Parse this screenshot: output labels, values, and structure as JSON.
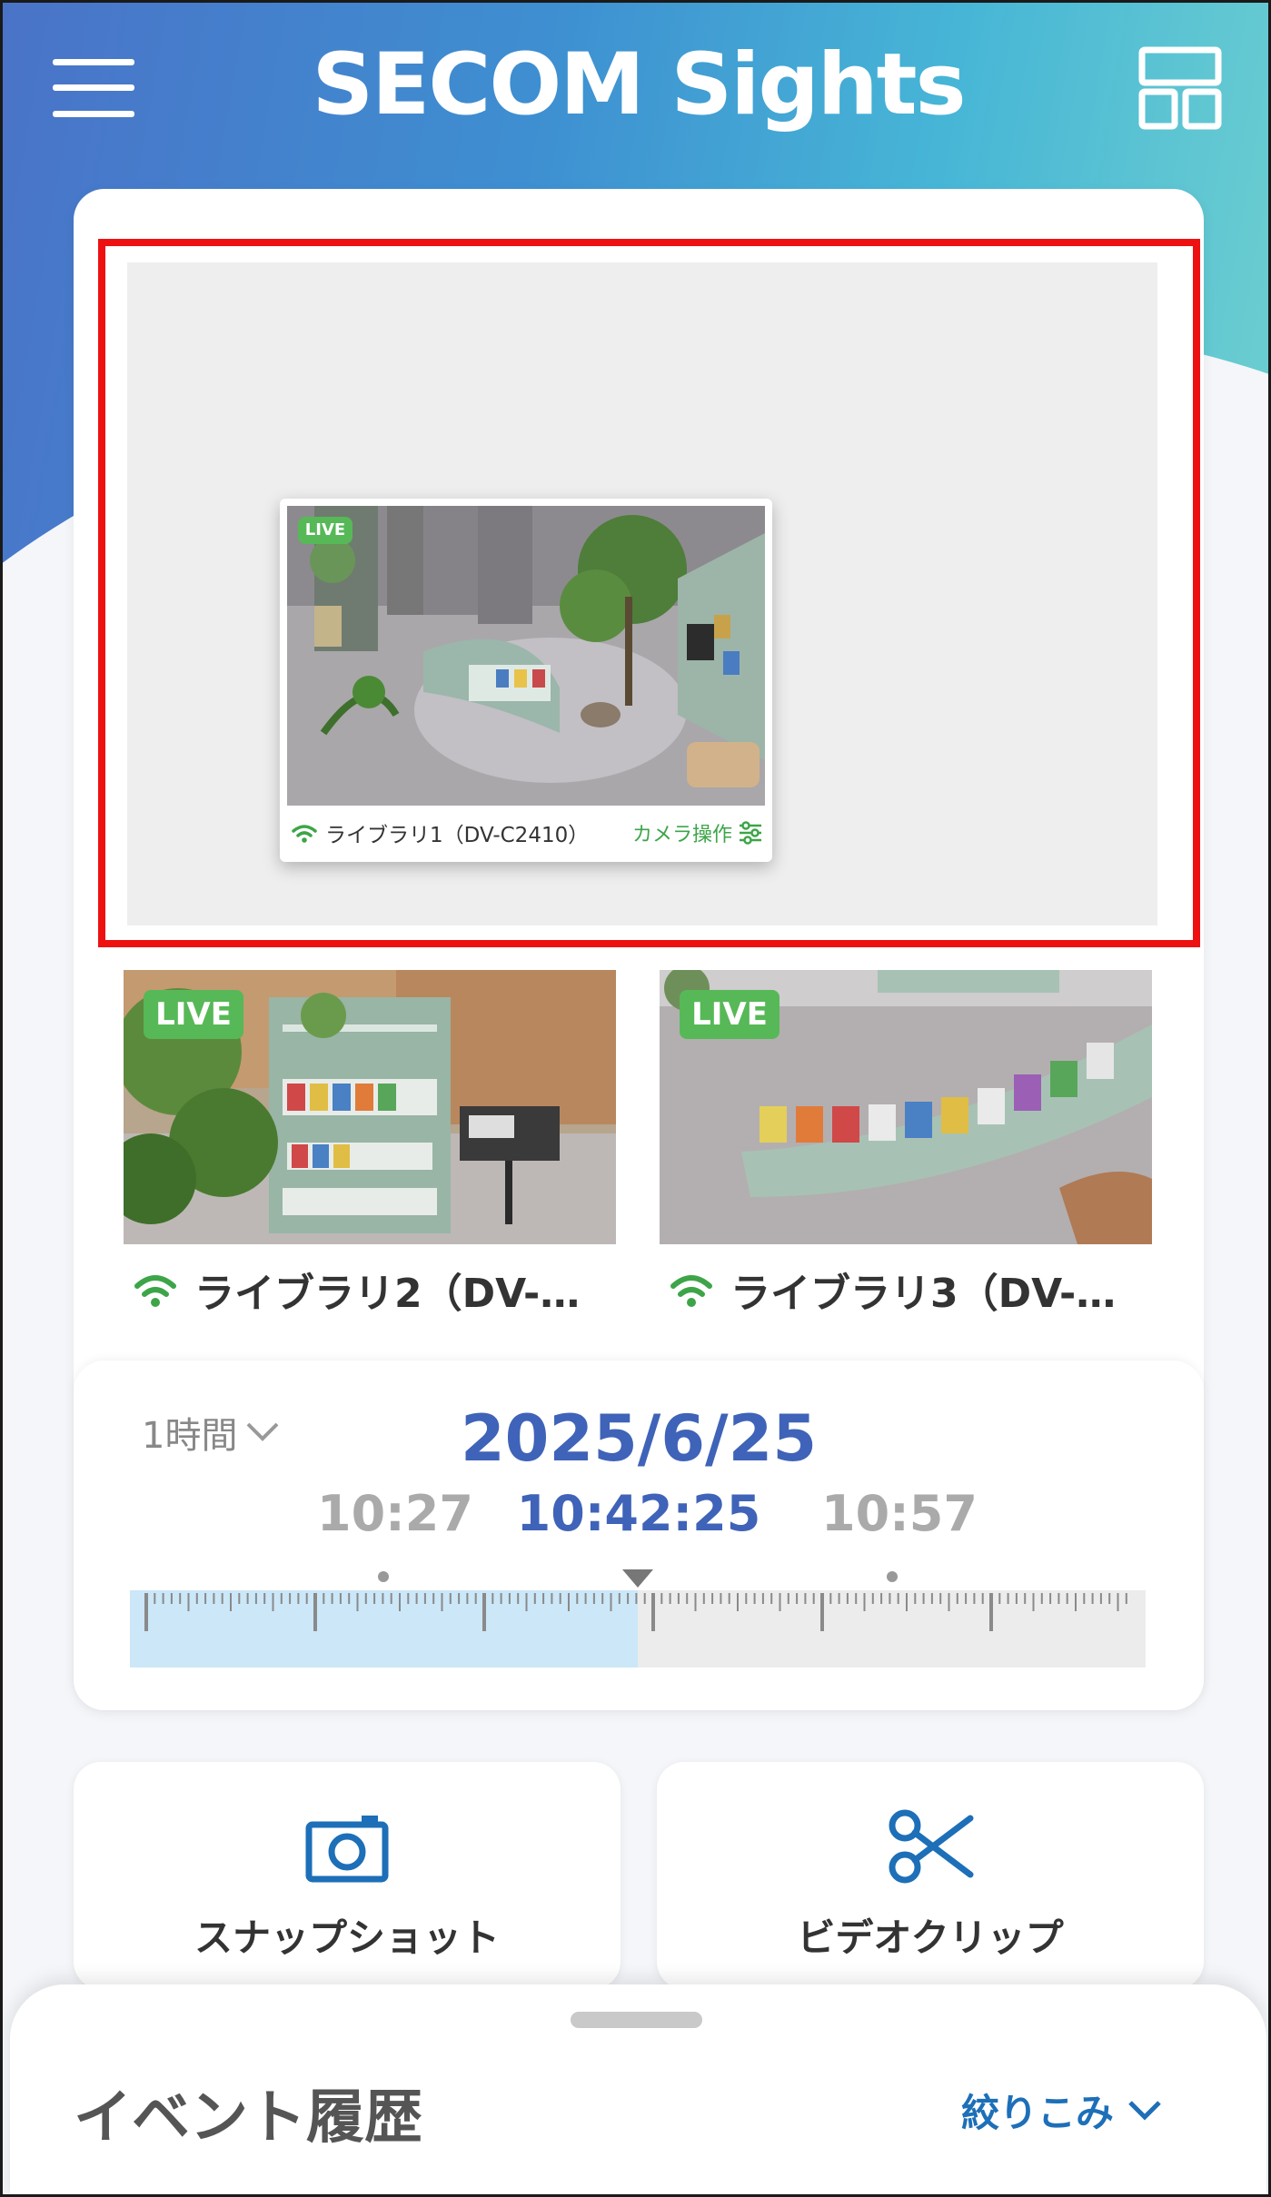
{
  "header": {
    "title": "SECOM Sights",
    "menu_icon": "hamburger-menu-icon",
    "layout_icon": "grid-layout-icon"
  },
  "primary_camera": {
    "badge": "LIVE",
    "name": "ライブラリ1（DV-C2410）",
    "control_label": "カメラ操作"
  },
  "cameras": [
    {
      "badge": "LIVE",
      "name": "ライブラリ2（DV-…"
    },
    {
      "badge": "LIVE",
      "name": "ライブラリ3（DV-…"
    }
  ],
  "timeline": {
    "range_label": "1時間",
    "date": "2025/6/25",
    "time_left": "10:27",
    "time_current": "10:42:25",
    "time_right": "10:57"
  },
  "actions": {
    "snapshot_label": "スナップショット",
    "videoclip_label": "ビデオクリップ"
  },
  "event_history": {
    "title": "イベント履歴",
    "filter_label": "絞りこみ"
  },
  "colors": {
    "accent_blue": "#3f63b8",
    "live_green": "#57b857",
    "highlight_red": "#ee1111",
    "icon_blue": "#1d6fb8"
  }
}
